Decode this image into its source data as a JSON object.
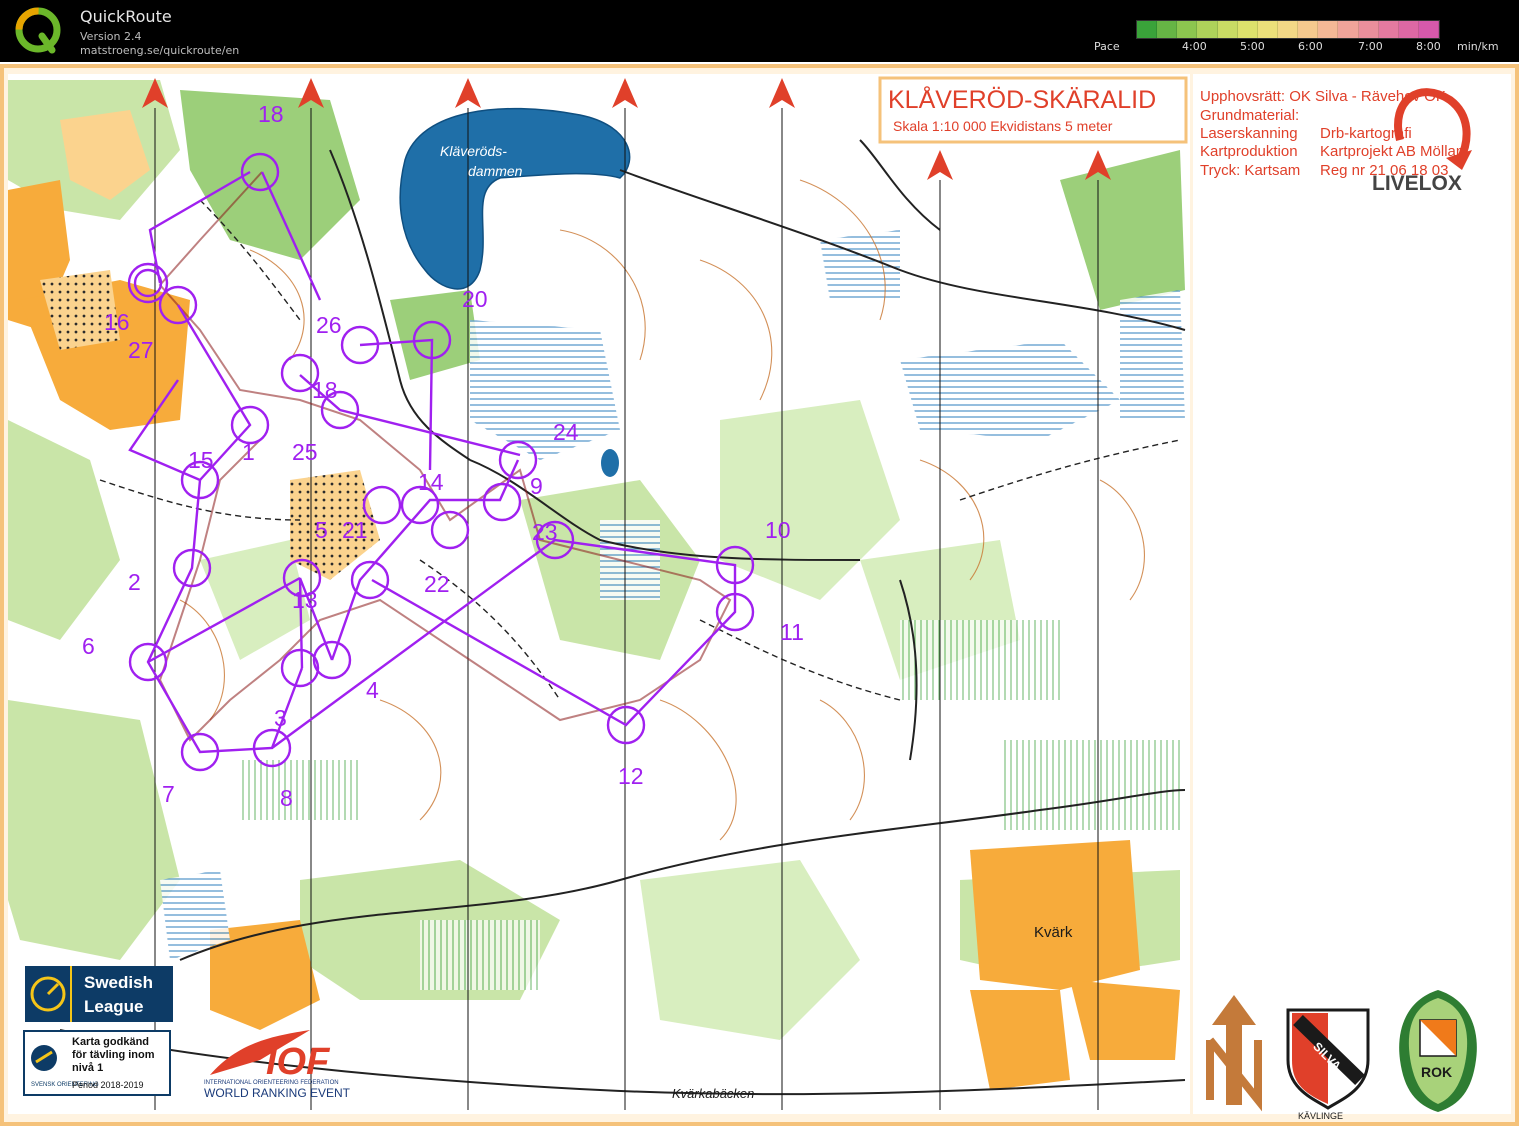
{
  "app": {
    "name": "QuickRoute",
    "version": "Version 2.4",
    "url": "matstroeng.se/quickroute/en"
  },
  "pace": {
    "label": "Pace",
    "ticks": [
      "4:00",
      "5:00",
      "6:00",
      "7:00",
      "8:00"
    ],
    "unit": "min/km",
    "colors": [
      "#3aa33a",
      "#66b545",
      "#8cc64f",
      "#aed25a",
      "#c9db64",
      "#dde16c",
      "#ece07a",
      "#f3d886",
      "#f5c98e",
      "#f4b896",
      "#f0a49a",
      "#ea8f9c",
      "#e47aa0",
      "#dd68a4",
      "#d659ab"
    ]
  },
  "map": {
    "title": "KLÅVERÖD-SKÄRALID",
    "scale_text": "Skala 1:10 000 Ekvidistans 5 meter",
    "credits": [
      "Upphovsrätt: OK Silva - Rävehov OK",
      "Grundmaterial:",
      "Laserskanning",
      "Drb-kartografi",
      "Kartproduktion",
      "Kartprojekt AB Möllam",
      "Tryck: Kartsam",
      "Reg nr 21 06 18 03"
    ],
    "place_names": [
      "Kläveröds-",
      "dammen",
      "Kvärk",
      "Kvärkabäcken"
    ],
    "control_labels": [
      "18",
      "16",
      "27",
      "26",
      "20",
      "18",
      "1",
      "25",
      "15",
      "24",
      "14",
      "9",
      "5",
      "21",
      "23",
      "22",
      "10",
      "2",
      "13",
      "11",
      "6",
      "4",
      "3",
      "12",
      "7",
      "8"
    ],
    "brand": "LIVELOX",
    "swedish_league": [
      "Swedish",
      "League"
    ],
    "karta_godkand": [
      "Karta godkänd",
      "för tävling inom",
      "nivå 1",
      "Period 2018-2019"
    ],
    "svensk_orientering": "SVENSK ORIENTERING",
    "iof": {
      "mark": "IOF",
      "full": "INTERNATIONAL ORIENTEERING FEDERATION",
      "event": "WORLD RANKING EVENT"
    },
    "silva": {
      "name": "SILVA",
      "place": "KÄVLINGE"
    },
    "rok": "ROK",
    "colors": {
      "course": "#a020f0",
      "route": "#8b1a1a",
      "water": "#1f6fa8",
      "field": "#f7ab3b",
      "forest_green": "#c9e5a8",
      "north_arrow": "#e0402a"
    }
  }
}
